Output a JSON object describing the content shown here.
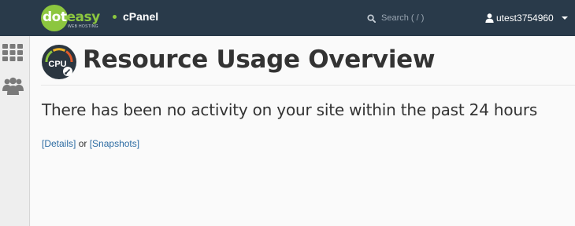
{
  "header": {
    "logo_dot": "dot",
    "logo_easy": "easy",
    "logo_sub": "WEB HOSTING",
    "brand": "cPanel",
    "search_placeholder": "Search ( / )",
    "username": "utest3754960",
    "bg_color": "#293a4a",
    "accent_color": "#8cc63f"
  },
  "sidebar": {
    "items": [
      {
        "icon": "grid-icon"
      },
      {
        "icon": "users-icon"
      }
    ]
  },
  "main": {
    "icon_label": "CPU",
    "title": "Resource Usage Overview",
    "message": "There has been no activity on your site within the past 24 hours",
    "details_link": "[Details]",
    "or_text": " or ",
    "snapshots_link": "[Snapshots]",
    "link_color": "#2d6ca3"
  }
}
